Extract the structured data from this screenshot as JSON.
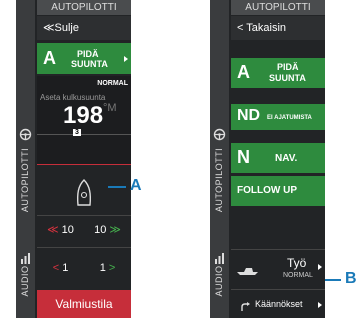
{
  "left_panel": {
    "title": "AUTOPILOTTI",
    "back_label": "≪Sulje",
    "mode": {
      "letter": "A",
      "line1": "PIDÄ",
      "line2": "SUUNTA"
    },
    "status": "NORMAL",
    "heading_label": "Aseta kulkusuunta",
    "heading_value": "198",
    "heading_unit": "°M",
    "rudder_value": "3",
    "sidebar_label": "AUTOPILOTTI",
    "audio_label": "AUDIO",
    "port_10": "10",
    "stbd_10": "10",
    "port_1": "1",
    "stbd_1": "1",
    "port_10_glyph": "≪",
    "stbd_10_glyph": "≫",
    "port_1_glyph": "<",
    "stbd_1_glyph": ">",
    "standby_label": "Valmiustila"
  },
  "right_panel": {
    "title": "AUTOPILOTTI",
    "back_label": "< Takaisin",
    "sidebar_label": "AUTOPILOTTI",
    "audio_label": "AUDIO",
    "modes": [
      {
        "letter": "A",
        "line1": "PIDÄ",
        "line2": "SUUNTA"
      },
      {
        "letter": "ND",
        "text": "EI AJATUMISTA"
      },
      {
        "letter": "N",
        "text": "NAV."
      },
      {
        "text": "FOLLOW UP"
      }
    ],
    "work_label": "Työ",
    "work_status": "NORMAL",
    "turns_label": "Käännökset"
  },
  "callouts": {
    "a": "A",
    "b": "B"
  },
  "colors": {
    "panel": "#222426",
    "accent_green": "#2e8b3e",
    "standby_red": "#c62e3a",
    "callout_blue": "#1a7ab8"
  }
}
